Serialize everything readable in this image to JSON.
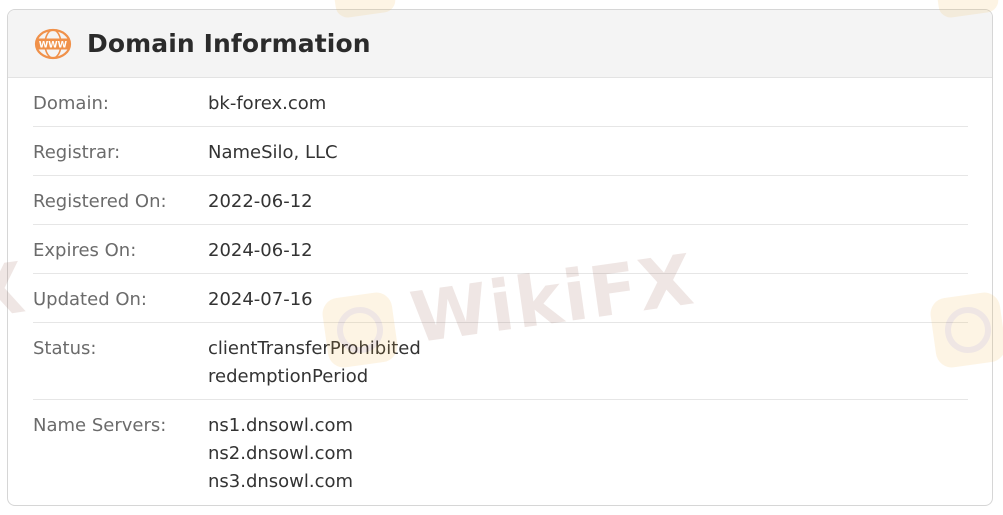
{
  "header": {
    "title": "Domain Information",
    "icon": "www-icon",
    "icon_text": "WWW",
    "accent_color": "#f0914a"
  },
  "watermark": {
    "text": "WikiFX",
    "left_fragment": "X"
  },
  "rows": [
    {
      "label": "Domain:",
      "values": [
        "bk-forex.com"
      ]
    },
    {
      "label": "Registrar:",
      "values": [
        "NameSilo, LLC"
      ]
    },
    {
      "label": "Registered On:",
      "values": [
        "2022-06-12"
      ]
    },
    {
      "label": "Expires On:",
      "values": [
        "2024-06-12"
      ]
    },
    {
      "label": "Updated On:",
      "values": [
        "2024-07-16"
      ]
    },
    {
      "label": "Status:",
      "values": [
        "clientTransferProhibited",
        "redemptionPeriod"
      ]
    },
    {
      "label": "Name Servers:",
      "values": [
        "ns1.dnsowl.com",
        "ns2.dnsowl.com",
        "ns3.dnsowl.com"
      ]
    }
  ]
}
